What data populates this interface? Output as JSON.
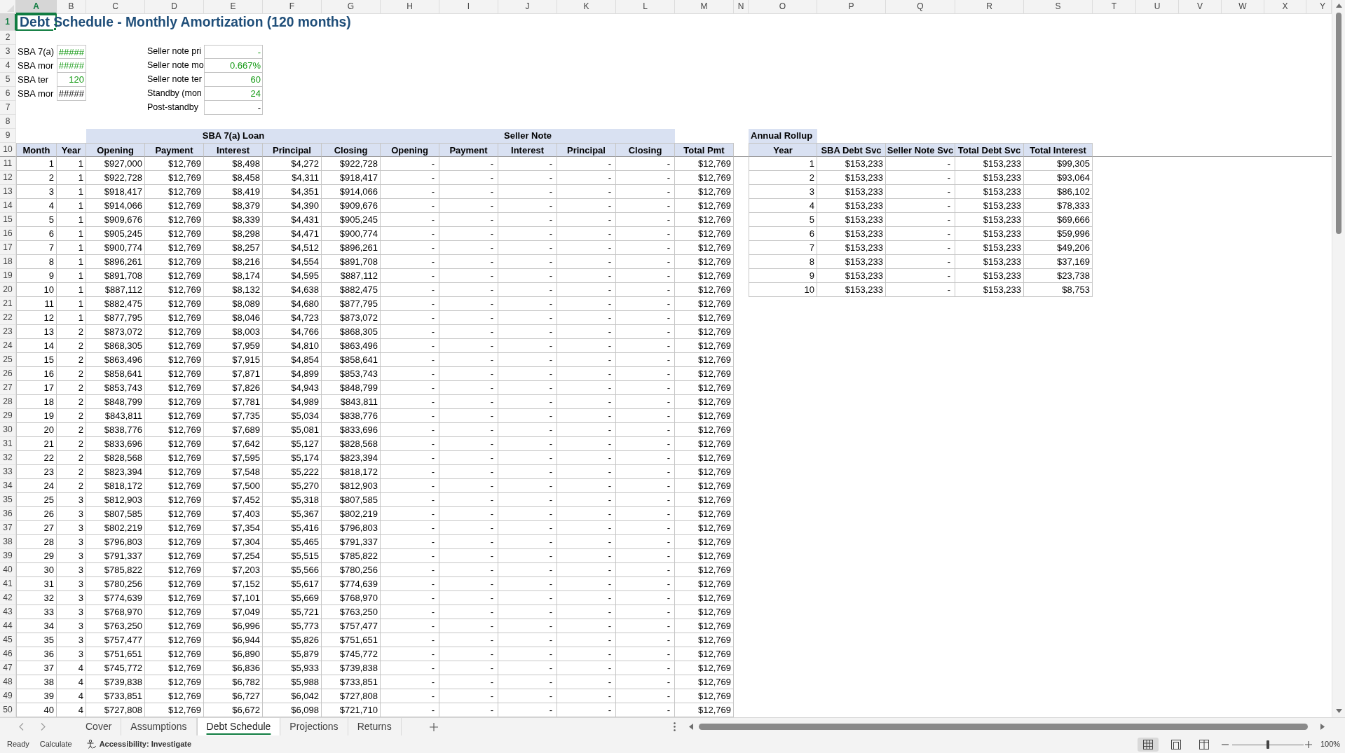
{
  "column_headers": [
    {
      "label": "A",
      "selected": true
    },
    {
      "label": "B",
      "selected": false
    },
    {
      "label": "C",
      "selected": false
    },
    {
      "label": "D",
      "selected": false
    },
    {
      "label": "E",
      "selected": false
    },
    {
      "label": "F",
      "selected": false
    },
    {
      "label": "G",
      "selected": false
    },
    {
      "label": "H",
      "selected": false
    },
    {
      "label": "I",
      "selected": false
    },
    {
      "label": "J",
      "selected": false
    },
    {
      "label": "K",
      "selected": false
    },
    {
      "label": "L",
      "selected": false
    },
    {
      "label": "M",
      "selected": false
    },
    {
      "label": "N",
      "selected": false
    },
    {
      "label": "O",
      "selected": false
    },
    {
      "label": "P",
      "selected": false
    },
    {
      "label": "Q",
      "selected": false
    },
    {
      "label": "R",
      "selected": false
    },
    {
      "label": "S",
      "selected": false
    },
    {
      "label": "T",
      "selected": false
    },
    {
      "label": "U",
      "selected": false
    },
    {
      "label": "V",
      "selected": false
    },
    {
      "label": "W",
      "selected": false
    },
    {
      "label": "X",
      "selected": false
    },
    {
      "label": "Y",
      "selected": false
    }
  ],
  "row_headers": [
    {
      "label": "1",
      "selected": true
    },
    {
      "label": "2",
      "selected": false
    },
    {
      "label": "3",
      "selected": false
    },
    {
      "label": "4",
      "selected": false
    },
    {
      "label": "5",
      "selected": false
    },
    {
      "label": "6",
      "selected": false
    },
    {
      "label": "7",
      "selected": false
    },
    {
      "label": "8",
      "selected": false
    },
    {
      "label": "9",
      "selected": false
    },
    {
      "label": "10",
      "selected": false
    },
    {
      "label": "11",
      "selected": false
    },
    {
      "label": "12",
      "selected": false
    },
    {
      "label": "13",
      "selected": false
    },
    {
      "label": "14",
      "selected": false
    },
    {
      "label": "15",
      "selected": false
    },
    {
      "label": "16",
      "selected": false
    },
    {
      "label": "17",
      "selected": false
    },
    {
      "label": "18",
      "selected": false
    },
    {
      "label": "19",
      "selected": false
    },
    {
      "label": "20",
      "selected": false
    },
    {
      "label": "21",
      "selected": false
    },
    {
      "label": "22",
      "selected": false
    },
    {
      "label": "23",
      "selected": false
    },
    {
      "label": "24",
      "selected": false
    },
    {
      "label": "25",
      "selected": false
    },
    {
      "label": "26",
      "selected": false
    },
    {
      "label": "27",
      "selected": false
    },
    {
      "label": "28",
      "selected": false
    },
    {
      "label": "29",
      "selected": false
    },
    {
      "label": "30",
      "selected": false
    },
    {
      "label": "31",
      "selected": false
    },
    {
      "label": "32",
      "selected": false
    },
    {
      "label": "33",
      "selected": false
    },
    {
      "label": "34",
      "selected": false
    },
    {
      "label": "35",
      "selected": false
    },
    {
      "label": "36",
      "selected": false
    },
    {
      "label": "37",
      "selected": false
    },
    {
      "label": "38",
      "selected": false
    },
    {
      "label": "39",
      "selected": false
    },
    {
      "label": "40",
      "selected": false
    },
    {
      "label": "41",
      "selected": false
    },
    {
      "label": "42",
      "selected": false
    },
    {
      "label": "43",
      "selected": false
    },
    {
      "label": "44",
      "selected": false
    },
    {
      "label": "45",
      "selected": false
    },
    {
      "label": "46",
      "selected": false
    },
    {
      "label": "47",
      "selected": false
    },
    {
      "label": "48",
      "selected": false
    },
    {
      "label": "49",
      "selected": false
    },
    {
      "label": "50",
      "selected": false
    }
  ],
  "title": "Debt Schedule - Monthly Amortization (120 months)",
  "sba_inputs": [
    {
      "label": "SBA 7(a)",
      "value": "#####",
      "kind": "input"
    },
    {
      "label": "SBA mor",
      "value": "#####",
      "kind": "input"
    },
    {
      "label": "SBA ter",
      "value": "120",
      "kind": "input"
    },
    {
      "label": "SBA mor",
      "value": "#####",
      "kind": "calculated"
    }
  ],
  "seller_note_inputs": [
    {
      "label": "Seller note pri",
      "value": "-",
      "kind": "input"
    },
    {
      "label": "Seller note mo",
      "value": "0.667%",
      "kind": "input"
    },
    {
      "label": "Seller note ter",
      "value": "60",
      "kind": "input"
    },
    {
      "label": "Standby (mon",
      "value": "24",
      "kind": "input"
    },
    {
      "label": "Post-standby",
      "value": "-",
      "kind": "calculated"
    }
  ],
  "schedule": {
    "groups": [
      {
        "label": "SBA 7(a) Loan"
      },
      {
        "label": "Seller Note"
      }
    ],
    "columns": [
      "Month",
      "Year",
      "Opening",
      "Payment",
      "Interest",
      "Principal",
      "Closing",
      "Opening",
      "Payment",
      "Interest",
      "Principal",
      "Closing",
      "Total Pmt"
    ],
    "rows": [
      [
        "1",
        "1",
        "$927,000",
        "$12,769",
        "$8,498",
        "$4,272",
        "$922,728",
        "-",
        "-",
        "-",
        "-",
        "-",
        "$12,769"
      ],
      [
        "2",
        "1",
        "$922,728",
        "$12,769",
        "$8,458",
        "$4,311",
        "$918,417",
        "-",
        "-",
        "-",
        "-",
        "-",
        "$12,769"
      ],
      [
        "3",
        "1",
        "$918,417",
        "$12,769",
        "$8,419",
        "$4,351",
        "$914,066",
        "-",
        "-",
        "-",
        "-",
        "-",
        "$12,769"
      ],
      [
        "4",
        "1",
        "$914,066",
        "$12,769",
        "$8,379",
        "$4,390",
        "$909,676",
        "-",
        "-",
        "-",
        "-",
        "-",
        "$12,769"
      ],
      [
        "5",
        "1",
        "$909,676",
        "$12,769",
        "$8,339",
        "$4,431",
        "$905,245",
        "-",
        "-",
        "-",
        "-",
        "-",
        "$12,769"
      ],
      [
        "6",
        "1",
        "$905,245",
        "$12,769",
        "$8,298",
        "$4,471",
        "$900,774",
        "-",
        "-",
        "-",
        "-",
        "-",
        "$12,769"
      ],
      [
        "7",
        "1",
        "$900,774",
        "$12,769",
        "$8,257",
        "$4,512",
        "$896,261",
        "-",
        "-",
        "-",
        "-",
        "-",
        "$12,769"
      ],
      [
        "8",
        "1",
        "$896,261",
        "$12,769",
        "$8,216",
        "$4,554",
        "$891,708",
        "-",
        "-",
        "-",
        "-",
        "-",
        "$12,769"
      ],
      [
        "9",
        "1",
        "$891,708",
        "$12,769",
        "$8,174",
        "$4,595",
        "$887,112",
        "-",
        "-",
        "-",
        "-",
        "-",
        "$12,769"
      ],
      [
        "10",
        "1",
        "$887,112",
        "$12,769",
        "$8,132",
        "$4,638",
        "$882,475",
        "-",
        "-",
        "-",
        "-",
        "-",
        "$12,769"
      ],
      [
        "11",
        "1",
        "$882,475",
        "$12,769",
        "$8,089",
        "$4,680",
        "$877,795",
        "-",
        "-",
        "-",
        "-",
        "-",
        "$12,769"
      ],
      [
        "12",
        "1",
        "$877,795",
        "$12,769",
        "$8,046",
        "$4,723",
        "$873,072",
        "-",
        "-",
        "-",
        "-",
        "-",
        "$12,769"
      ],
      [
        "13",
        "2",
        "$873,072",
        "$12,769",
        "$8,003",
        "$4,766",
        "$868,305",
        "-",
        "-",
        "-",
        "-",
        "-",
        "$12,769"
      ],
      [
        "14",
        "2",
        "$868,305",
        "$12,769",
        "$7,959",
        "$4,810",
        "$863,496",
        "-",
        "-",
        "-",
        "-",
        "-",
        "$12,769"
      ],
      [
        "15",
        "2",
        "$863,496",
        "$12,769",
        "$7,915",
        "$4,854",
        "$858,641",
        "-",
        "-",
        "-",
        "-",
        "-",
        "$12,769"
      ],
      [
        "16",
        "2",
        "$858,641",
        "$12,769",
        "$7,871",
        "$4,899",
        "$853,743",
        "-",
        "-",
        "-",
        "-",
        "-",
        "$12,769"
      ],
      [
        "17",
        "2",
        "$853,743",
        "$12,769",
        "$7,826",
        "$4,943",
        "$848,799",
        "-",
        "-",
        "-",
        "-",
        "-",
        "$12,769"
      ],
      [
        "18",
        "2",
        "$848,799",
        "$12,769",
        "$7,781",
        "$4,989",
        "$843,811",
        "-",
        "-",
        "-",
        "-",
        "-",
        "$12,769"
      ],
      [
        "19",
        "2",
        "$843,811",
        "$12,769",
        "$7,735",
        "$5,034",
        "$838,776",
        "-",
        "-",
        "-",
        "-",
        "-",
        "$12,769"
      ],
      [
        "20",
        "2",
        "$838,776",
        "$12,769",
        "$7,689",
        "$5,081",
        "$833,696",
        "-",
        "-",
        "-",
        "-",
        "-",
        "$12,769"
      ],
      [
        "21",
        "2",
        "$833,696",
        "$12,769",
        "$7,642",
        "$5,127",
        "$828,568",
        "-",
        "-",
        "-",
        "-",
        "-",
        "$12,769"
      ],
      [
        "22",
        "2",
        "$828,568",
        "$12,769",
        "$7,595",
        "$5,174",
        "$823,394",
        "-",
        "-",
        "-",
        "-",
        "-",
        "$12,769"
      ],
      [
        "23",
        "2",
        "$823,394",
        "$12,769",
        "$7,548",
        "$5,222",
        "$818,172",
        "-",
        "-",
        "-",
        "-",
        "-",
        "$12,769"
      ],
      [
        "24",
        "2",
        "$818,172",
        "$12,769",
        "$7,500",
        "$5,270",
        "$812,903",
        "-",
        "-",
        "-",
        "-",
        "-",
        "$12,769"
      ],
      [
        "25",
        "3",
        "$812,903",
        "$12,769",
        "$7,452",
        "$5,318",
        "$807,585",
        "-",
        "-",
        "-",
        "-",
        "-",
        "$12,769"
      ],
      [
        "26",
        "3",
        "$807,585",
        "$12,769",
        "$7,403",
        "$5,367",
        "$802,219",
        "-",
        "-",
        "-",
        "-",
        "-",
        "$12,769"
      ],
      [
        "27",
        "3",
        "$802,219",
        "$12,769",
        "$7,354",
        "$5,416",
        "$796,803",
        "-",
        "-",
        "-",
        "-",
        "-",
        "$12,769"
      ],
      [
        "28",
        "3",
        "$796,803",
        "$12,769",
        "$7,304",
        "$5,465",
        "$791,337",
        "-",
        "-",
        "-",
        "-",
        "-",
        "$12,769"
      ],
      [
        "29",
        "3",
        "$791,337",
        "$12,769",
        "$7,254",
        "$5,515",
        "$785,822",
        "-",
        "-",
        "-",
        "-",
        "-",
        "$12,769"
      ],
      [
        "30",
        "3",
        "$785,822",
        "$12,769",
        "$7,203",
        "$5,566",
        "$780,256",
        "-",
        "-",
        "-",
        "-",
        "-",
        "$12,769"
      ],
      [
        "31",
        "3",
        "$780,256",
        "$12,769",
        "$7,152",
        "$5,617",
        "$774,639",
        "-",
        "-",
        "-",
        "-",
        "-",
        "$12,769"
      ],
      [
        "32",
        "3",
        "$774,639",
        "$12,769",
        "$7,101",
        "$5,669",
        "$768,970",
        "-",
        "-",
        "-",
        "-",
        "-",
        "$12,769"
      ],
      [
        "33",
        "3",
        "$768,970",
        "$12,769",
        "$7,049",
        "$5,721",
        "$763,250",
        "-",
        "-",
        "-",
        "-",
        "-",
        "$12,769"
      ],
      [
        "34",
        "3",
        "$763,250",
        "$12,769",
        "$6,996",
        "$5,773",
        "$757,477",
        "-",
        "-",
        "-",
        "-",
        "-",
        "$12,769"
      ],
      [
        "35",
        "3",
        "$757,477",
        "$12,769",
        "$6,944",
        "$5,826",
        "$751,651",
        "-",
        "-",
        "-",
        "-",
        "-",
        "$12,769"
      ],
      [
        "36",
        "3",
        "$751,651",
        "$12,769",
        "$6,890",
        "$5,879",
        "$745,772",
        "-",
        "-",
        "-",
        "-",
        "-",
        "$12,769"
      ],
      [
        "37",
        "4",
        "$745,772",
        "$12,769",
        "$6,836",
        "$5,933",
        "$739,838",
        "-",
        "-",
        "-",
        "-",
        "-",
        "$12,769"
      ],
      [
        "38",
        "4",
        "$739,838",
        "$12,769",
        "$6,782",
        "$5,988",
        "$733,851",
        "-",
        "-",
        "-",
        "-",
        "-",
        "$12,769"
      ],
      [
        "39",
        "4",
        "$733,851",
        "$12,769",
        "$6,727",
        "$6,042",
        "$727,808",
        "-",
        "-",
        "-",
        "-",
        "-",
        "$12,769"
      ],
      [
        "40",
        "4",
        "$727,808",
        "$12,769",
        "$6,672",
        "$6,098",
        "$721,710",
        "-",
        "-",
        "-",
        "-",
        "-",
        "$12,769"
      ]
    ]
  },
  "annual_rollup": {
    "title": "Annual Rollup",
    "columns": [
      "Year",
      "SBA Debt Svc",
      "Seller Note Svc",
      "Total Debt Svc",
      "Total Interest"
    ],
    "rows": [
      [
        "1",
        "$153,233",
        "-",
        "$153,233",
        "$99,305"
      ],
      [
        "2",
        "$153,233",
        "-",
        "$153,233",
        "$93,064"
      ],
      [
        "3",
        "$153,233",
        "-",
        "$153,233",
        "$86,102"
      ],
      [
        "4",
        "$153,233",
        "-",
        "$153,233",
        "$78,333"
      ],
      [
        "5",
        "$153,233",
        "-",
        "$153,233",
        "$69,666"
      ],
      [
        "6",
        "$153,233",
        "-",
        "$153,233",
        "$59,996"
      ],
      [
        "7",
        "$153,233",
        "-",
        "$153,233",
        "$49,206"
      ],
      [
        "8",
        "$153,233",
        "-",
        "$153,233",
        "$37,169"
      ],
      [
        "9",
        "$153,233",
        "-",
        "$153,233",
        "$23,738"
      ],
      [
        "10",
        "$153,233",
        "-",
        "$153,233",
        "$8,753"
      ]
    ]
  },
  "sheet_tabs": [
    {
      "label": "Cover",
      "selected": false
    },
    {
      "label": "Assumptions",
      "selected": false
    },
    {
      "label": "Debt Schedule",
      "selected": true
    },
    {
      "label": "Projections",
      "selected": false
    },
    {
      "label": "Returns",
      "selected": false
    }
  ],
  "status_bar": {
    "mode": "Ready",
    "calculate": "Calculate",
    "accessibility": "Accessibility: Investigate",
    "views": [
      {
        "kind": "normal",
        "selected": true
      },
      {
        "kind": "page_layout",
        "selected": false
      },
      {
        "kind": "page_break",
        "selected": false
      }
    ],
    "zoom_slider": {
      "level": 0.5
    },
    "zoom": "100%"
  }
}
